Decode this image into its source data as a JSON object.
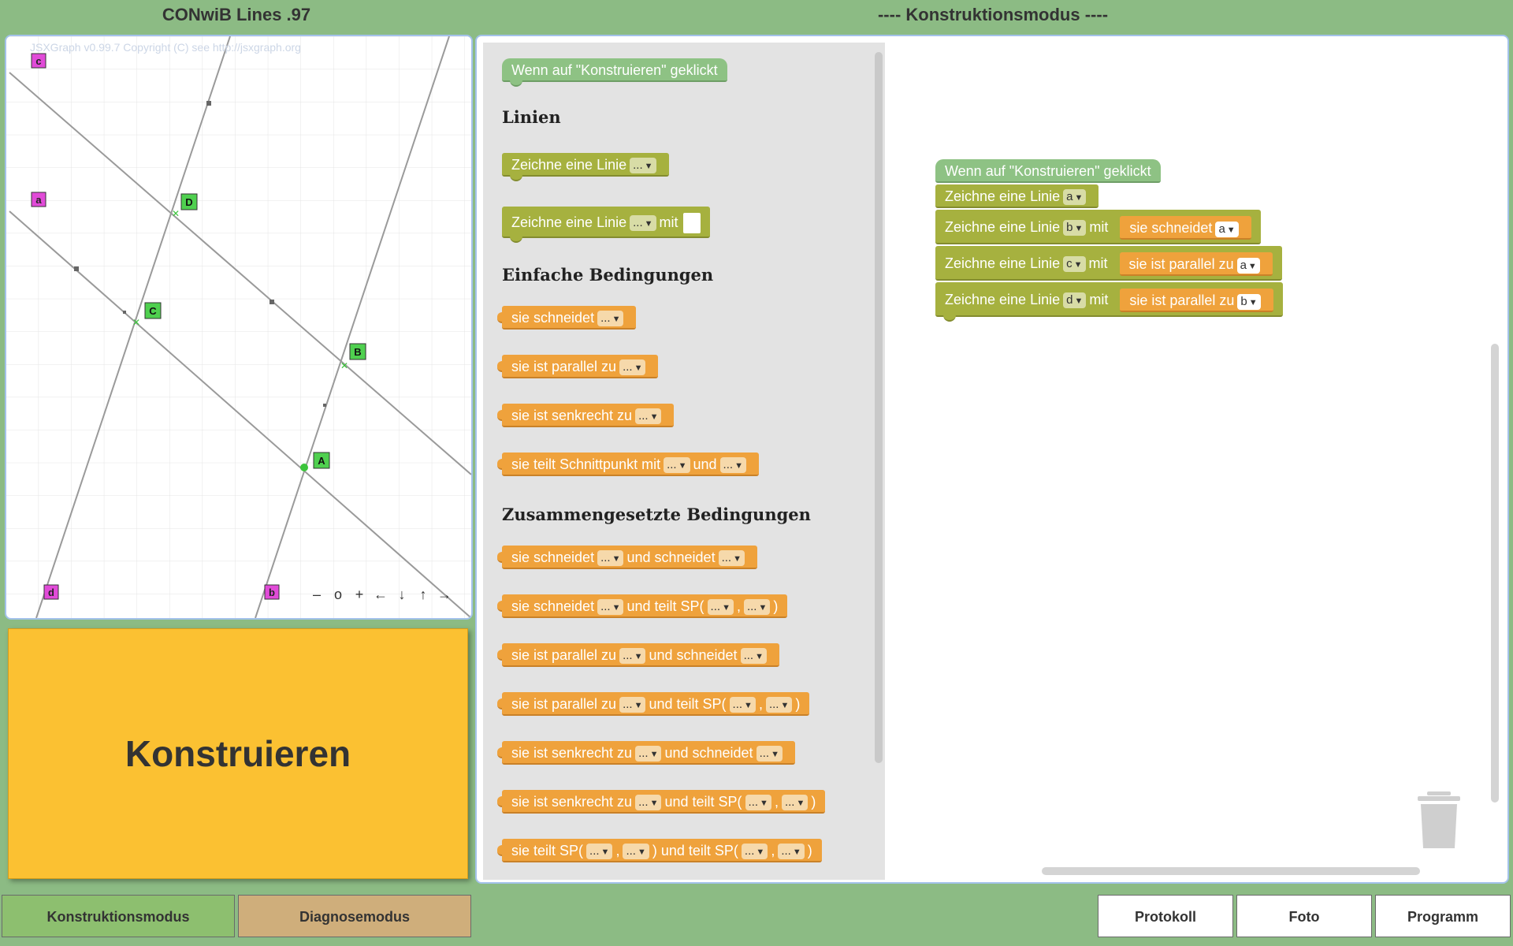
{
  "app_title": "CONwiB Lines .97",
  "mode_title": "---- Konstruktionsmodus ----",
  "board": {
    "copyright": "JSXGraph v0.99.7 Copyright (C) see http://jsxgraph.org",
    "line_labels": [
      "a",
      "b",
      "c",
      "d"
    ],
    "point_labels": [
      "A",
      "B",
      "C",
      "D"
    ],
    "nav": [
      "–",
      "o",
      "+",
      "←",
      "↓",
      "↑",
      "→"
    ]
  },
  "konstruieren_button": "Konstruieren",
  "flyout": {
    "event_block": "Wenn auf \"Konstruieren\" geklickt",
    "cat_linien": "Linien",
    "draw_line": "Zeichne eine Linie",
    "dd_placeholder": "...",
    "mit": "mit",
    "cat_simple": "Einfache Bedingungen",
    "simple": [
      "sie schneidet",
      "sie ist parallel zu",
      "sie ist senkrecht zu"
    ],
    "teilt_prefix": "sie teilt Schnittpunkt mit",
    "und": "und",
    "cat_compound": "Zusammengesetzte Bedingungen",
    "w_schneidet": "sie schneidet",
    "w_parallel": "sie ist parallel zu",
    "w_senkrecht": "sie ist senkrecht zu",
    "w_und_schneidet": "und schneidet",
    "w_und_teilt_sp": "und teilt SP(",
    "w_teilt_sp": "sie teilt SP(",
    "w_close_und_teilt_sp": ") und teilt SP(",
    "comma": ",",
    "close": ")"
  },
  "program": {
    "event_block": "Wenn auf \"Konstruieren\" geklickt",
    "draw_line": "Zeichne eine Linie",
    "mit": "mit",
    "lines": [
      {
        "name": "a"
      },
      {
        "name": "b",
        "cond": "sie schneidet",
        "ref": "a"
      },
      {
        "name": "c",
        "cond": "sie ist parallel zu",
        "ref": "a"
      },
      {
        "name": "d",
        "cond": "sie ist parallel zu",
        "ref": "b"
      }
    ]
  },
  "tabs": {
    "konstruktion": "Konstruktionsmodus",
    "diagnose": "Diagnosemodus"
  },
  "buttons": {
    "protokoll": "Protokoll",
    "foto": "Foto",
    "programm": "Programm"
  }
}
